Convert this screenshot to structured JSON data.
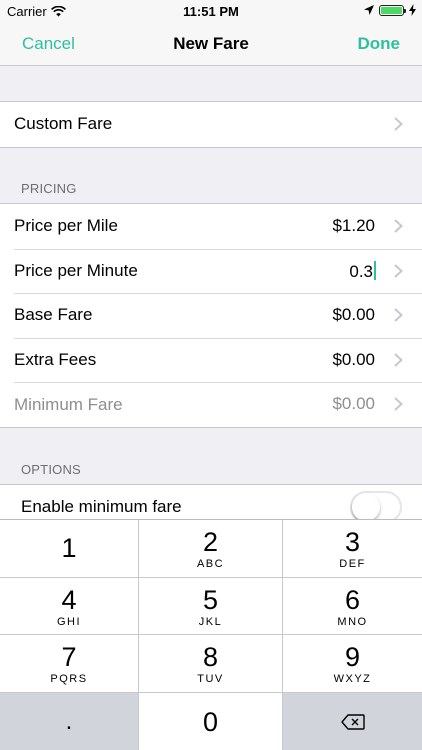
{
  "status_bar": {
    "carrier": "Carrier",
    "time": "11:51 PM",
    "icons": [
      "wifi-icon",
      "location-arrow-icon",
      "battery-icon",
      "charging-bolt-icon"
    ],
    "battery_color": "#4cd964"
  },
  "nav": {
    "left": "Cancel",
    "title": "New Fare",
    "right": "Done",
    "accent_color": "#2fbf9e"
  },
  "custom_fare": {
    "label": "Custom Fare"
  },
  "pricing": {
    "header": "PRICING",
    "rows": [
      {
        "label": "Price per Mile",
        "value": "$1.20"
      },
      {
        "label": "Price per Minute",
        "value": "0.3"
      },
      {
        "label": "Base Fare",
        "value": "$0.00"
      },
      {
        "label": "Extra Fees",
        "value": "$0.00"
      },
      {
        "label": "Minimum Fare",
        "value": "$0.00"
      }
    ]
  },
  "options": {
    "header": "OPTIONS",
    "enable_minimum_fare": {
      "label": "Enable minimum fare",
      "on": false
    }
  },
  "keypad": {
    "keys": [
      {
        "digit": "1",
        "letters": ""
      },
      {
        "digit": "2",
        "letters": "ABC"
      },
      {
        "digit": "3",
        "letters": "DEF"
      },
      {
        "digit": "4",
        "letters": "GHI"
      },
      {
        "digit": "5",
        "letters": "JKL"
      },
      {
        "digit": "6",
        "letters": "MNO"
      },
      {
        "digit": "7",
        "letters": "PQRS"
      },
      {
        "digit": "8",
        "letters": "TUV"
      },
      {
        "digit": "9",
        "letters": "WXYZ"
      }
    ],
    "decimal": ".",
    "zero": "0",
    "delete_icon": "backspace-icon"
  }
}
